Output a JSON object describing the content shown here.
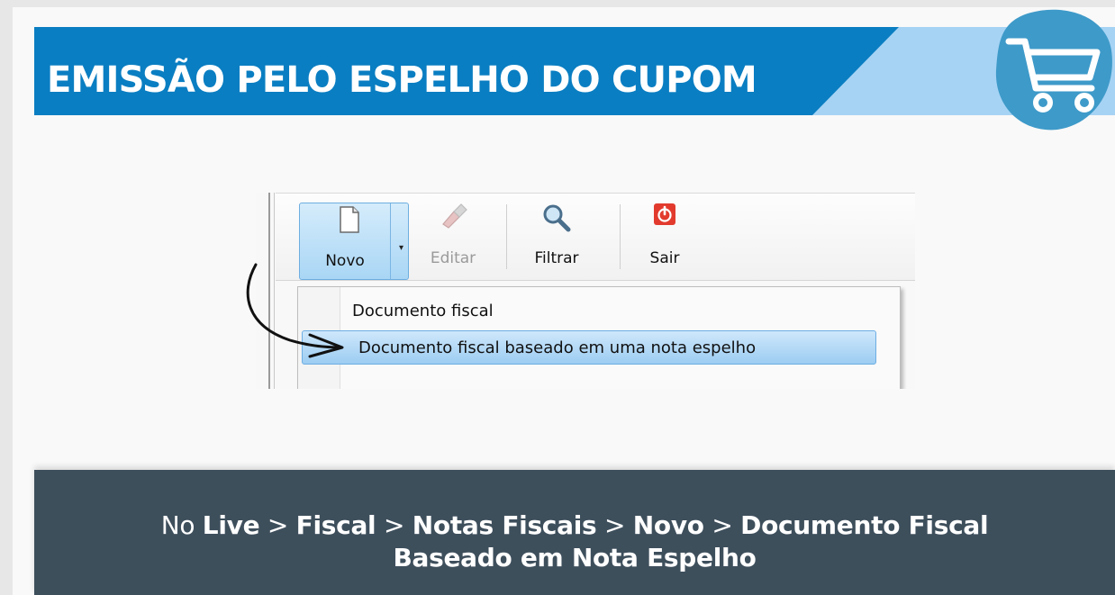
{
  "header": {
    "title": "EMISSÃO PELO ESPELHO DO CUPOM",
    "badge_icon": "shopping-cart-icon",
    "colors": {
      "dark": "#0a7ec2",
      "light": "#a6d3f4",
      "badge": "#3e9ac9"
    }
  },
  "toolbar": {
    "novo": {
      "label": "Novo",
      "icon": "new-document-icon"
    },
    "editar": {
      "label": "Editar",
      "icon": "edit-brush-icon",
      "disabled": true
    },
    "filtrar": {
      "label": "Filtrar",
      "icon": "magnifier-icon"
    },
    "sair": {
      "label": "Sair",
      "icon": "power-exit-icon"
    }
  },
  "menu": {
    "items": [
      {
        "label": "Documento fiscal"
      },
      {
        "label": "Documento fiscal baseado em uma nota espelho",
        "highlighted": true
      }
    ]
  },
  "footer": {
    "prefix": "No",
    "path": [
      "Live",
      "Fiscal",
      "Notas Fiscais",
      "Novo",
      "Documento Fiscal",
      "Baseado em Nota Espelho"
    ],
    "separator": ">",
    "background": "#3e4f5c"
  }
}
